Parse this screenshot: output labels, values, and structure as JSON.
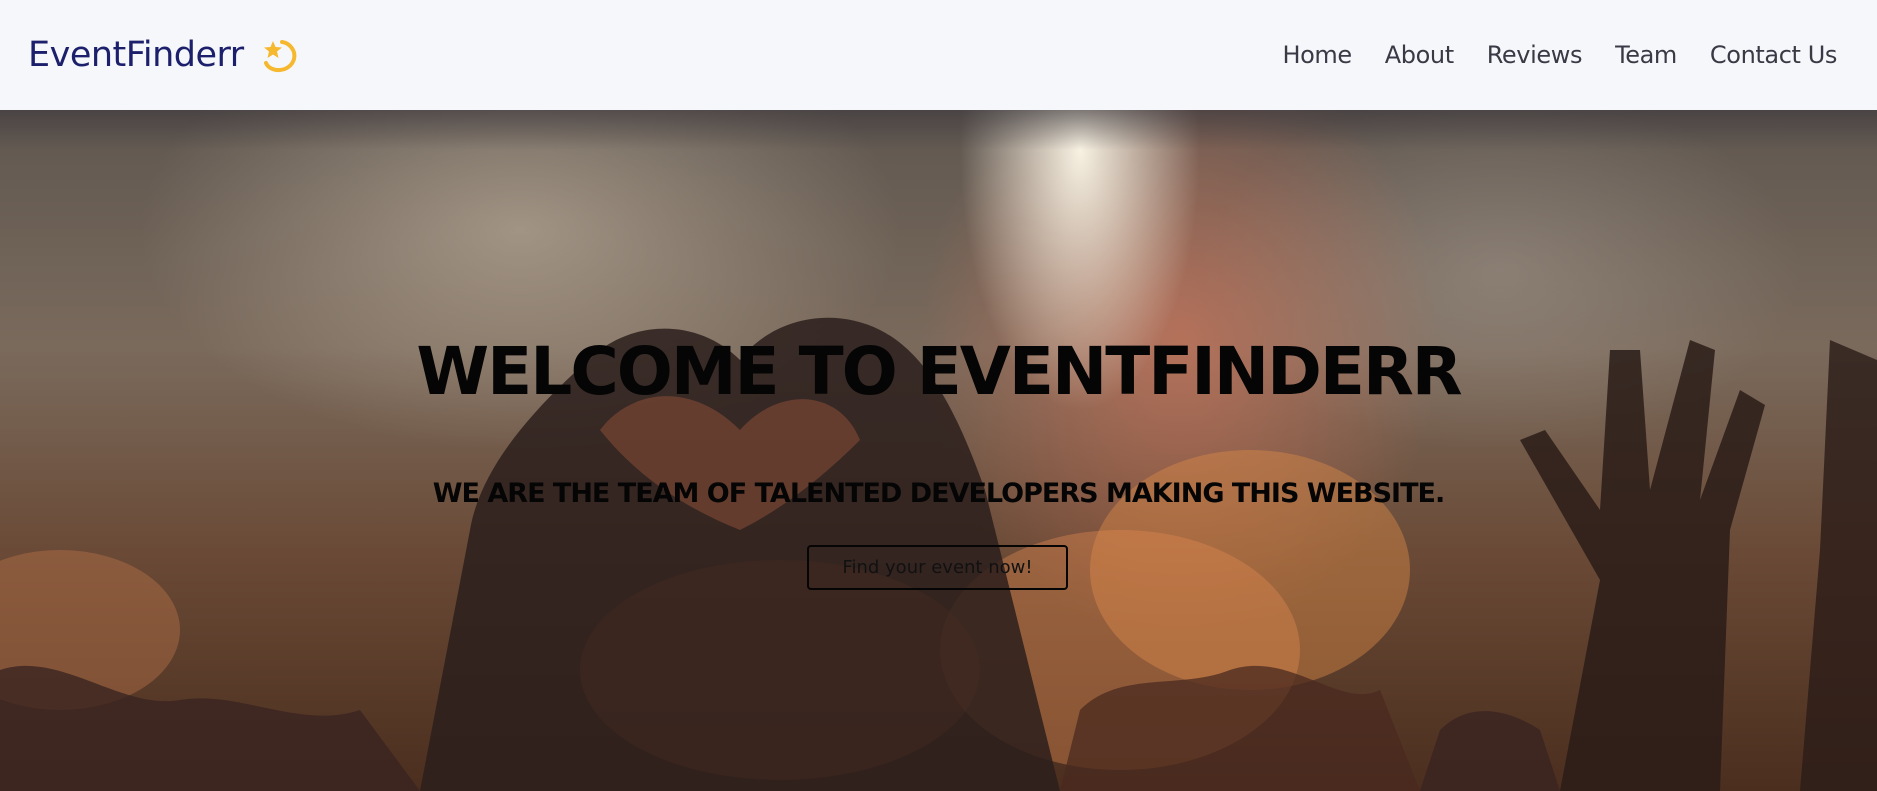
{
  "brand": {
    "name": "EventFinderr",
    "icon": "shooting-star-icon",
    "color": "#1c1f6b",
    "icon_color": "#f5b82e"
  },
  "nav": {
    "items": [
      {
        "label": "Home"
      },
      {
        "label": "About"
      },
      {
        "label": "Reviews"
      },
      {
        "label": "Team"
      },
      {
        "label": "Contact Us"
      }
    ]
  },
  "hero": {
    "title": "WELCOME TO EVENTFINDERR",
    "subtitle": "WE ARE THE TEAM OF TALENTED DEVELOPERS MAKING THIS WEBSITE.",
    "cta_label": "Find your event now!",
    "background": "concert-crowd-heart-hands-photo"
  }
}
